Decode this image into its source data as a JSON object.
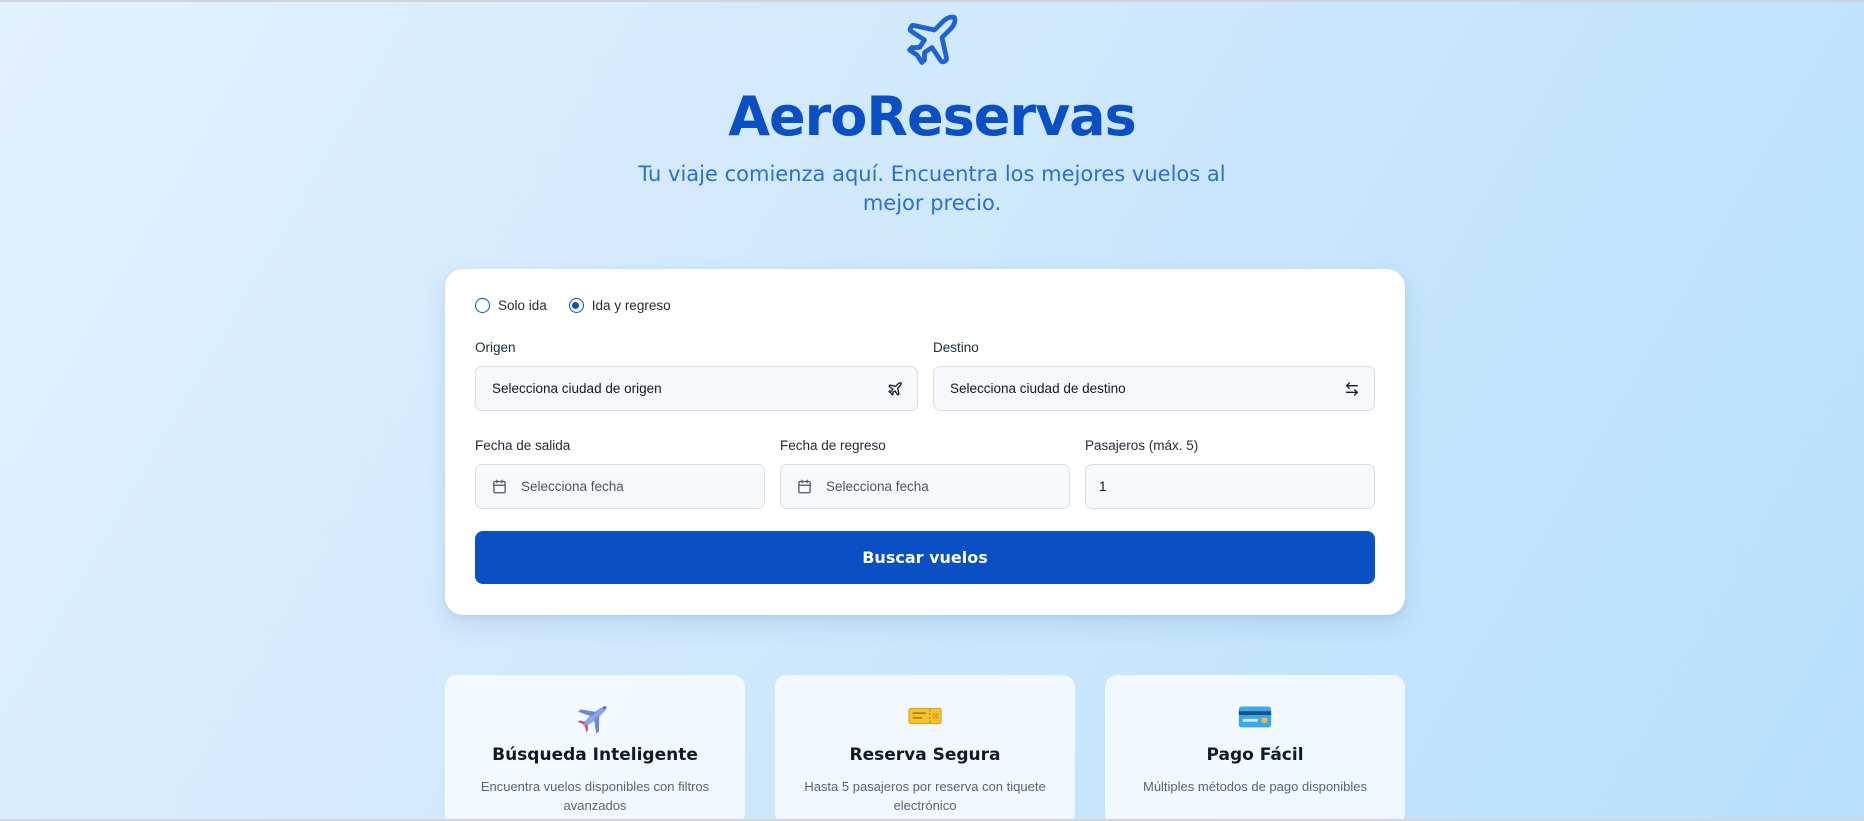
{
  "brand": {
    "name": "AeroReservas",
    "tagline": "Tu viaje comienza aquí. Encuentra los mejores vuelos al mejor precio.",
    "icon": "airplane-icon"
  },
  "colors": {
    "primary": "#0b4fc4",
    "tagline": "#2b6fd4",
    "card_bg": "#ffffff"
  },
  "search": {
    "trip_types": [
      {
        "label": "Solo ida",
        "selected": false
      },
      {
        "label": "Ida y regreso",
        "selected": true
      }
    ],
    "origin": {
      "label": "Origen",
      "value": "Selecciona ciudad de origen",
      "icon": "airplane-icon"
    },
    "destination": {
      "label": "Destino",
      "value": "Selecciona ciudad de destino",
      "icon": "swap-icon"
    },
    "departure": {
      "label": "Fecha de salida",
      "placeholder": "Selecciona fecha",
      "icon": "calendar-icon"
    },
    "return": {
      "label": "Fecha de regreso",
      "placeholder": "Selecciona fecha",
      "icon": "calendar-icon"
    },
    "passengers": {
      "label": "Pasajeros (máx. 5)",
      "value": "1"
    },
    "submit_label": "Buscar vuelos"
  },
  "features": [
    {
      "icon": "airplane-emoji-icon",
      "title": "Búsqueda Inteligente",
      "desc": "Encuentra vuelos disponibles con filtros avanzados"
    },
    {
      "icon": "ticket-icon",
      "title": "Reserva Segura",
      "desc": "Hasta 5 pasajeros por reserva con tiquete electrónico"
    },
    {
      "icon": "credit-card-icon",
      "title": "Pago Fácil",
      "desc": "Múltiples métodos de pago disponibles"
    }
  ]
}
